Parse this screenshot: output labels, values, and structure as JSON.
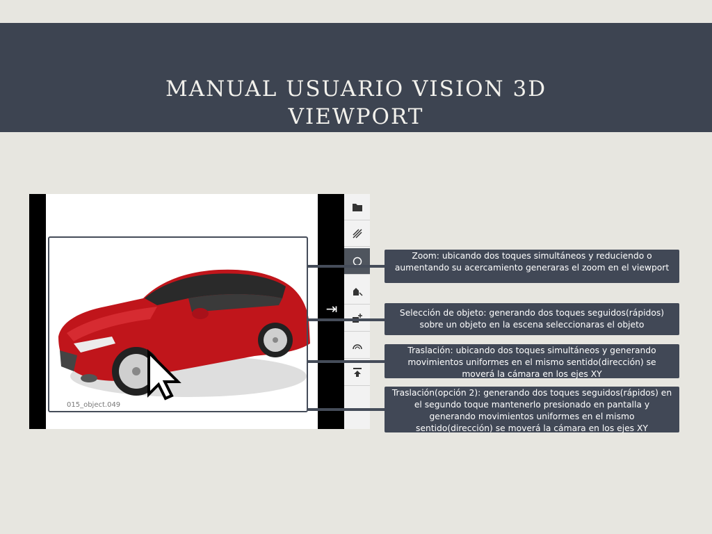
{
  "header": {
    "title_line1": "MANUAL USUARIO VISION 3D",
    "title_line2": "VIEWPORT"
  },
  "viewport": {
    "object_label": "015_object.049",
    "toolbar": [
      {
        "name": "folder-icon",
        "active": false
      },
      {
        "name": "hatch-pattern-icon",
        "active": false
      },
      {
        "name": "orbit-circle-icon",
        "active": true
      },
      {
        "name": "move-object-icon",
        "active": false
      },
      {
        "name": "add-object-icon",
        "active": false
      },
      {
        "name": "arc-icon",
        "active": false
      },
      {
        "name": "align-top-icon",
        "active": false
      }
    ]
  },
  "callouts": [
    {
      "text": "Zoom: ubicando dos toques simultáneos y reduciendo o aumentando su acercamiento generaras el zoom en el viewport"
    },
    {
      "text": "Selección de objeto: generando dos toques seguidos(rápidos) sobre un objeto en la escena seleccionaras el objeto"
    },
    {
      "text": "Traslación: ubicando dos toques simultáneos y generando movimientos uniformes en el mismo sentido(dirección) se moverá la cámara en los ejes XY"
    },
    {
      "text": "Traslación(opción 2): generando dos toques seguidos(rápidos) en el segundo toque mantenerlo presionado en pantalla y generando movimientos uniformes en el mismo sentido(dirección) se moverá la cámara en los ejes XY"
    }
  ],
  "colors": {
    "background": "#e7e6e0",
    "header_band": "#3d4451",
    "callout": "#414856",
    "car_body": "#c0151b"
  }
}
